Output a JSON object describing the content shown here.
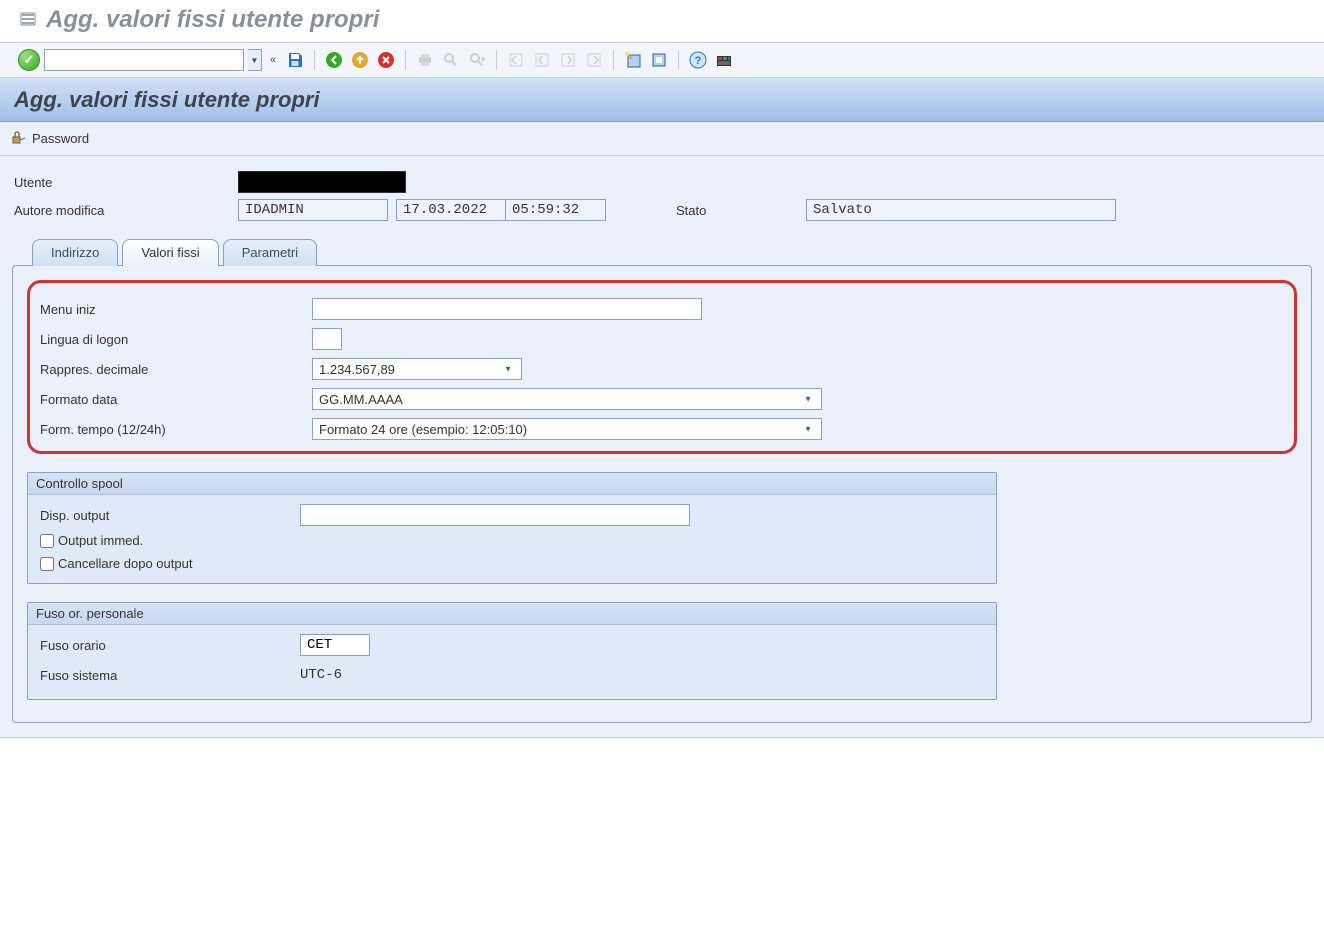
{
  "window_title": "Agg. valori fissi utente propri",
  "page_title": "Agg. valori fissi utente propri",
  "sub_toolbar": {
    "password_label": "Password"
  },
  "header": {
    "utente_label": "Utente",
    "utente_value": "",
    "autore_modifica_label": "Autore modifica",
    "autore_modifica_value": "IDADMIN",
    "date_value": "17.03.2022",
    "time_value": "05:59:32",
    "stato_label": "Stato",
    "stato_value": "Salvato"
  },
  "tabs": {
    "indirizzo": "Indirizzo",
    "valori_fissi": "Valori fissi",
    "parametri": "Parametri"
  },
  "defaults": {
    "menu_iniz_label": "Menu iniz",
    "menu_iniz_value": "",
    "lingua_logon_label": "Lingua di logon",
    "lingua_logon_value": "",
    "rappres_decimale_label": "Rappres. decimale",
    "rappres_decimale_value": "1.234.567,89",
    "formato_data_label": "Formato data",
    "formato_data_value": "GG.MM.AAAA",
    "form_tempo_label": "Form. tempo (12/24h)",
    "form_tempo_value": "Formato 24 ore (esempio: 12:05:10)"
  },
  "spool": {
    "group_title": "Controllo spool",
    "disp_output_label": "Disp. output",
    "disp_output_value": "",
    "output_immed_label": "Output immed.",
    "cancellare_dopo_label": "Cancellare dopo output"
  },
  "timezone": {
    "group_title": "Fuso or. personale",
    "fuso_orario_label": "Fuso orario",
    "fuso_orario_value": "CET",
    "fuso_sistema_label": "Fuso sistema",
    "fuso_sistema_value": "UTC-6"
  }
}
